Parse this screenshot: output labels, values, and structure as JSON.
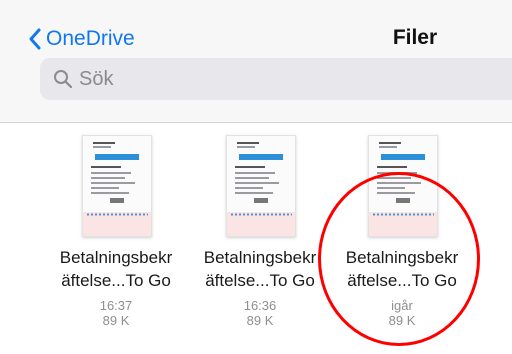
{
  "nav": {
    "back_label": "OneDrive",
    "title": "Filer"
  },
  "search": {
    "placeholder": "Sök"
  },
  "files": [
    {
      "name_line1": "Betalningsbekr",
      "name_line2": "äftelse...To Go",
      "time": "16:37",
      "size": "89 K"
    },
    {
      "name_line1": "Betalningsbekr",
      "name_line2": "äftelse...To Go",
      "time": "16:36",
      "size": "89 K"
    },
    {
      "name_line1": "Betalningsbekr",
      "name_line2": "äftelse...To Go",
      "time": "igår",
      "size": "89 K"
    }
  ],
  "colors": {
    "accent": "#1277ee",
    "annotation": "#ff0000",
    "meta_text": "#8e8e93"
  },
  "icons": {
    "back": "chevron-left-icon",
    "search": "search-icon",
    "file": "document-thumbnail"
  }
}
